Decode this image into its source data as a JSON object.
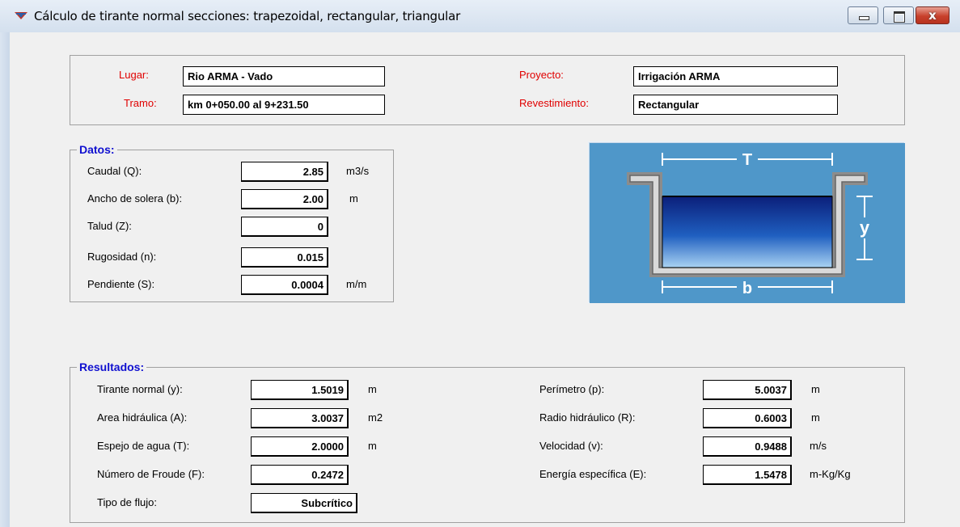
{
  "window": {
    "title": "Cálculo de tirante normal secciones: trapezoidal, rectangular, triangular",
    "close_glyph": "x"
  },
  "header": {
    "lugar_label": "Lugar:",
    "lugar_value": "Rio ARMA - Vado",
    "tramo_label": "Tramo:",
    "tramo_value": "km 0+050.00 al 9+231.50",
    "proyecto_label": "Proyecto:",
    "proyecto_value": "Irrigación ARMA",
    "revestimiento_label": "Revestimiento:",
    "revestimiento_value": "Rectangular"
  },
  "datos": {
    "title": "Datos:",
    "rows": [
      {
        "label": "Caudal (Q):",
        "value": "2.85",
        "unit": "m3/s"
      },
      {
        "label": "Ancho de solera (b):",
        "value": "2.00",
        "unit": "m"
      },
      {
        "label": "Talud (Z):",
        "value": "0",
        "unit": ""
      },
      {
        "label": "Rugosidad (n):",
        "value": "0.015",
        "unit": ""
      },
      {
        "label": "Pendiente (S):",
        "value": "0.0004",
        "unit": "m/m"
      }
    ]
  },
  "diagram": {
    "label_top": "T",
    "label_side": "y",
    "label_bottom": "b",
    "colors": {
      "background": "#4f97c9",
      "water": "#1f5fc0",
      "wall": "#d9d9d9"
    }
  },
  "resultados": {
    "title": "Resultados:",
    "left": [
      {
        "label": "Tirante normal (y):",
        "value": "1.5019",
        "unit": "m"
      },
      {
        "label": "Area hidráulica (A):",
        "value": "3.0037",
        "unit": "m2"
      },
      {
        "label": "Espejo de agua (T):",
        "value": "2.0000",
        "unit": "m"
      },
      {
        "label": "Número de Froude (F):",
        "value": "0.2472",
        "unit": ""
      },
      {
        "label": "Tipo de flujo:",
        "value": "Subcrítico",
        "unit": ""
      }
    ],
    "right": [
      {
        "label": "Perímetro (p):",
        "value": "5.0037",
        "unit": "m"
      },
      {
        "label": "Radio hidráulico (R):",
        "value": "0.6003",
        "unit": "m"
      },
      {
        "label": "Velocidad (v):",
        "value": "0.9488",
        "unit": "m/s"
      },
      {
        "label": "Energía específica (E):",
        "value": "1.5478",
        "unit": "m-Kg/Kg"
      }
    ]
  }
}
